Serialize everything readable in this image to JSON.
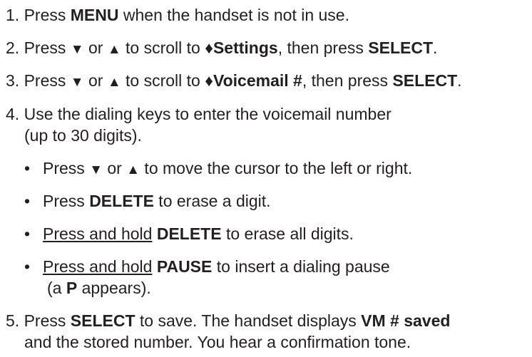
{
  "steps": [
    {
      "num": "1.",
      "lines": [
        [
          {
            "t": " Press "
          },
          {
            "t": "MENU",
            "b": true
          },
          {
            "t": " when the handset is not in use."
          }
        ]
      ]
    },
    {
      "num": "2.",
      "lines": [
        [
          {
            "t": " Press "
          },
          {
            "t": "▼",
            "g": true
          },
          {
            "t": " or "
          },
          {
            "t": "▲",
            "g": true
          },
          {
            "t": " to scroll to "
          },
          {
            "t": "♦Settings",
            "b": true
          },
          {
            "t": ", then press "
          },
          {
            "t": "SELECT",
            "b": true
          },
          {
            "t": "."
          }
        ]
      ]
    },
    {
      "num": "3.",
      "lines": [
        [
          {
            "t": " Press "
          },
          {
            "t": "▼",
            "g": true
          },
          {
            "t": " or "
          },
          {
            "t": "▲",
            "g": true
          },
          {
            "t": " to scroll to "
          },
          {
            "t": "♦Voicemail #",
            "b": true
          },
          {
            "t": ", then press "
          },
          {
            "t": "SELECT",
            "b": true
          },
          {
            "t": "."
          }
        ]
      ]
    },
    {
      "num": "4.",
      "lines": [
        [
          {
            "t": " Use the dialing keys to enter the voicemail number"
          }
        ],
        [
          {
            "t": "(up to 30 digits)."
          }
        ]
      ]
    },
    {
      "bullet": "•",
      "lines": [
        [
          {
            "t": "Press "
          },
          {
            "t": "▼",
            "g": true
          },
          {
            "t": " or "
          },
          {
            "t": "▲",
            "g": true
          },
          {
            "t": " to move the cursor to the left or right."
          }
        ]
      ]
    },
    {
      "bullet": "•",
      "lines": [
        [
          {
            "t": "Press "
          },
          {
            "t": "DELETE",
            "b": true
          },
          {
            "t": " to erase a digit."
          }
        ]
      ]
    },
    {
      "bullet": "•",
      "lines": [
        [
          {
            "t": "Press and hold",
            "u": true
          },
          {
            "t": " "
          },
          {
            "t": "DELETE",
            "b": true
          },
          {
            "t": " to erase all digits."
          }
        ]
      ]
    },
    {
      "bullet": "•",
      "lines": [
        [
          {
            "t": "Press and hold",
            "u": true
          },
          {
            "t": " "
          },
          {
            "t": "PAUSE",
            "b": true
          },
          {
            "t": " to insert a dialing pause"
          }
        ],
        [
          {
            "t": "(a "
          },
          {
            "t": "P",
            "b": true
          },
          {
            "t": " appears)."
          }
        ]
      ]
    },
    {
      "num": "5.",
      "lines": [
        [
          {
            "t": "  Press "
          },
          {
            "t": "SELECT",
            "b": true
          },
          {
            "t": " to save. The handset displays "
          },
          {
            "t": "VM # saved",
            "b": true
          }
        ],
        [
          {
            "t": "and the stored number. You hear a confirmation tone."
          }
        ]
      ]
    }
  ]
}
